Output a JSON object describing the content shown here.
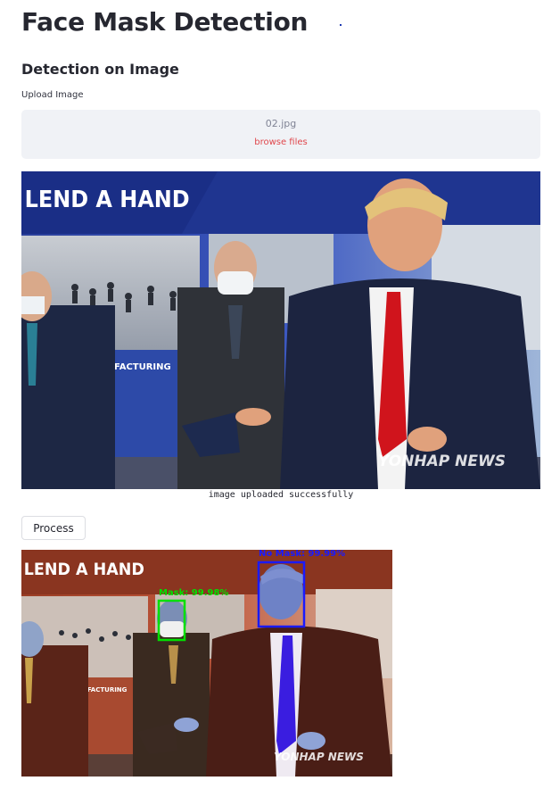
{
  "page": {
    "title": "Face Mask Detection",
    "subtitle": "Detection on Image",
    "upload_label": "Upload Image"
  },
  "uploader": {
    "filename": "02.jpg",
    "browse_label": "browse files"
  },
  "uploaded_image": {
    "banner_text": "LEND A HAND",
    "manufacturing_text": "L MANUFACTURING",
    "watermark": "YONHAP NEWS"
  },
  "status": {
    "caption": "image uploaded successfully"
  },
  "process_button": {
    "label": "Process"
  },
  "result_image": {
    "banner_text": "LEND A HAND",
    "manufacturing_text": "L MANUFACTURING",
    "watermark": "YONHAP NEWS",
    "detections": [
      {
        "label": "Mask: 99.98%",
        "color": "#00e000"
      },
      {
        "label": "No Mask: 99.99%",
        "color": "#1a1aff"
      }
    ]
  },
  "colors": {
    "browse_link": "#e0474c",
    "dropzone_bg": "#f0f2f6",
    "tie_red": "#d0141c",
    "tie_blue": "#3a1de0",
    "suit_navy": "#1c2440"
  }
}
